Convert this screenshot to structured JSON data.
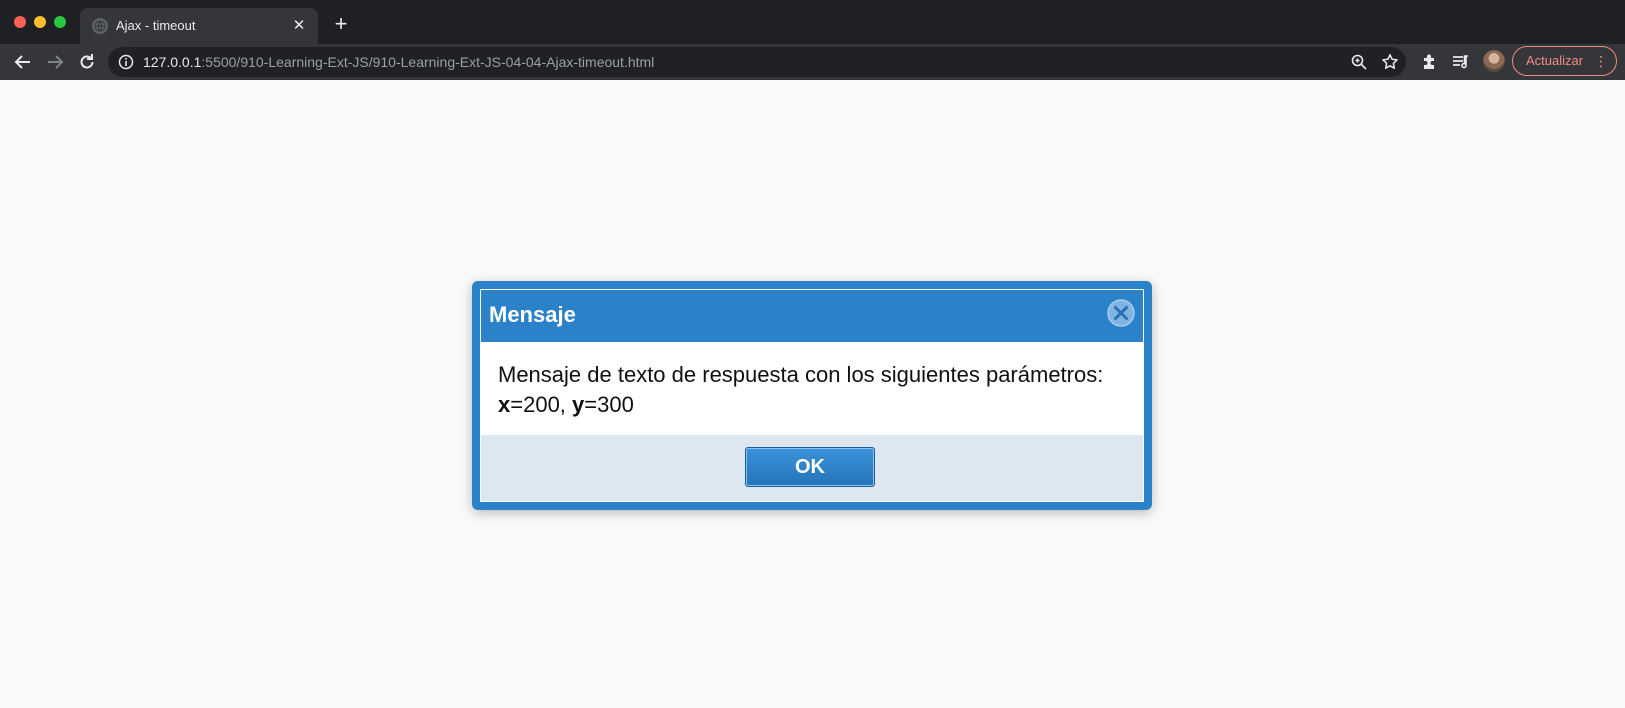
{
  "browser": {
    "tab": {
      "title": "Ajax - timeout",
      "close": "✕"
    },
    "new_tab": "+",
    "url": {
      "host": "127.0.0.1",
      "path": ":5500/910-Learning-Ext-JS/910-Learning-Ext-JS-04-04-Ajax-timeout.html"
    },
    "update_button": "Actualizar",
    "update_menu": "⋮",
    "icons": [
      "back-arrow-icon",
      "forward-arrow-icon",
      "reload-icon",
      "site-info-icon",
      "zoom-icon",
      "star-icon",
      "extensions-icon",
      "reading-list-icon",
      "avatar"
    ]
  },
  "dialog": {
    "title": "Mensaje",
    "message_prefix": "Mensaje de texto de respuesta con los siguientes parámetros:",
    "x_label": "x",
    "x_value": "=200, ",
    "y_label": "y",
    "y_value": "=300",
    "ok_label": "OK"
  },
  "colors": {
    "dialog_blue": "#2c82c9",
    "footer_bg": "#dce7f2",
    "update_accent": "#f28b82"
  }
}
